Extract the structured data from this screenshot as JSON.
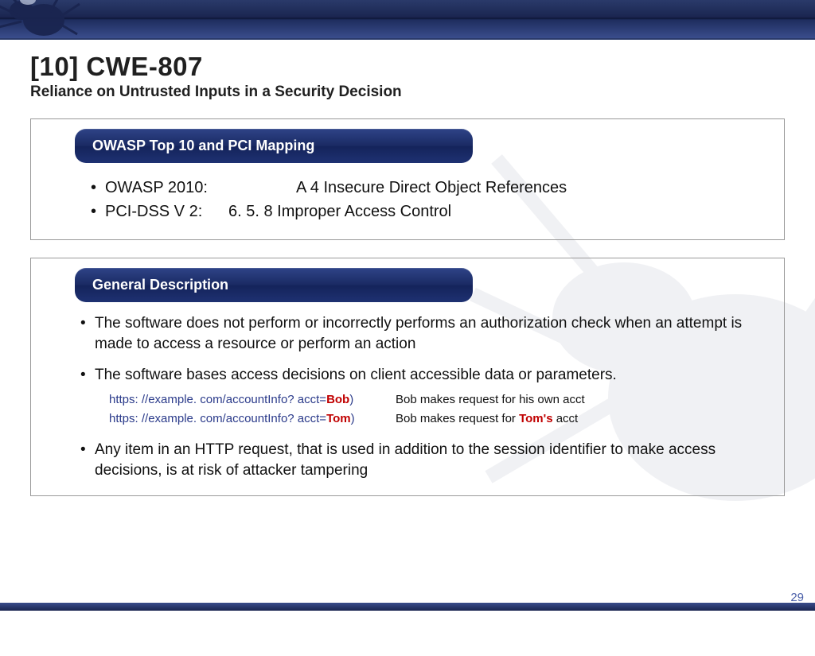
{
  "title": "[10] CWE-807",
  "subtitle": "Reliance on Untrusted Inputs in a Security Decision",
  "section1": {
    "header": "OWASP Top 10 and PCI Mapping",
    "b1_label": "OWASP 2010:",
    "b1_value": "A 4 Insecure Direct Object References",
    "b2_label": "PCI-DSS V 2:",
    "b2_value": "6. 5. 8 Improper Access Control"
  },
  "section2": {
    "header": "General Description",
    "b1": "The software does not perform or incorrectly performs an authorization check when an attempt is made to access a resource or perform an action",
    "b2": "The software bases access decisions on client accessible data or parameters.",
    "url1_pre": "https: //example. com/accountInfo? acct=",
    "url1_hl": "Bob",
    "url1_post": ")",
    "url1_desc": "Bob makes request for his own acct",
    "url2_pre": "https: //example. com/accountInfo? acct=",
    "url2_hl": "Tom",
    "url2_post": ")",
    "url2_desc_pre": "Bob makes request for ",
    "url2_desc_hl": "Tom's",
    "url2_desc_post": " acct",
    "b3": "Any item in an HTTP request, that is used in addition to the session identifier to make access decisions, is at risk of attacker tampering"
  },
  "page": "29"
}
